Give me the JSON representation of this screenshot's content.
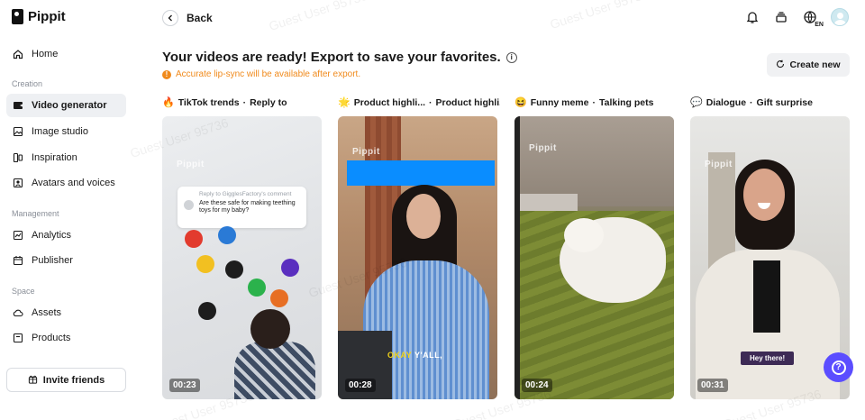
{
  "app": {
    "name": "Pippit"
  },
  "sidebar": {
    "top_items": [
      {
        "label": "Home",
        "icon": "home-icon"
      }
    ],
    "sections": [
      {
        "label": "Creation",
        "items": [
          {
            "label": "Video generator",
            "icon": "video-icon",
            "active": true
          },
          {
            "label": "Image studio",
            "icon": "image-icon"
          },
          {
            "label": "Inspiration",
            "icon": "inspiration-icon"
          },
          {
            "label": "Avatars and voices",
            "icon": "avatar-icon"
          }
        ]
      },
      {
        "label": "Management",
        "items": [
          {
            "label": "Analytics",
            "icon": "analytics-icon"
          },
          {
            "label": "Publisher",
            "icon": "calendar-icon"
          }
        ]
      },
      {
        "label": "Space",
        "items": [
          {
            "label": "Assets",
            "icon": "cloud-icon"
          },
          {
            "label": "Products",
            "icon": "box-icon"
          }
        ]
      }
    ],
    "invite_label": "Invite friends"
  },
  "header": {
    "back_label": "Back",
    "language_badge": "EN"
  },
  "main": {
    "headline": "Your videos are ready! Export to save your favorites.",
    "notice": "Accurate lip-sync will be available after export.",
    "create_label": "Create new",
    "cards": [
      {
        "emoji": "🔥",
        "category": "TikTok trends",
        "subtitle": "Reply to",
        "duration": "00:23",
        "comment_from": "Reply to GigglesFactory's comment",
        "comment_text": "Are these safe for making teething toys for my baby?",
        "watermark": "Pippit"
      },
      {
        "emoji": "🌟",
        "category": "Product highli...",
        "subtitle": "Product highli...",
        "duration": "00:28",
        "caption_a": "OKAY",
        "caption_b": "Y'ALL,",
        "watermark": "Pippit"
      },
      {
        "emoji": "😆",
        "category": "Funny meme",
        "subtitle": "Talking pets",
        "duration": "00:24",
        "watermark": "Pippit"
      },
      {
        "emoji": "💬",
        "category": "Dialogue",
        "subtitle": "Gift surprise",
        "duration": "00:31",
        "caption": "Hey there!",
        "watermark": "Pippit"
      }
    ]
  },
  "watermark_text": "Guest User 95736"
}
